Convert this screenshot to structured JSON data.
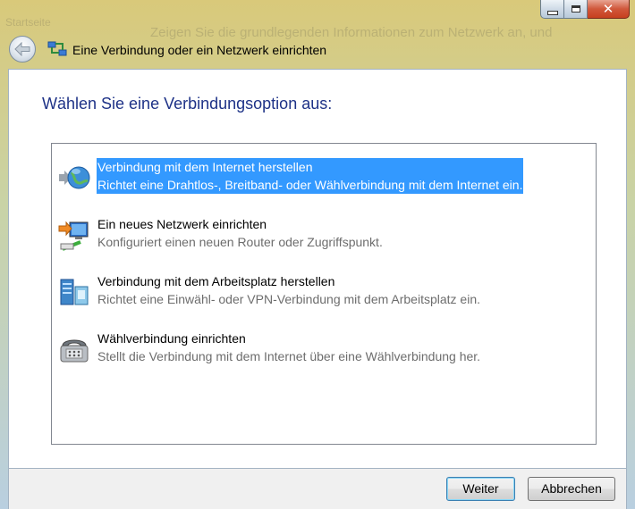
{
  "window": {
    "title": "Eine Verbindung oder ein Netzwerk einrichten",
    "background_text": "Zeigen Sie die grundlegenden Informationen zum Netzwerk an, und",
    "background_text_left": "Startseite",
    "close_glyph": "✕"
  },
  "main": {
    "heading": "Wählen Sie eine Verbindungsoption aus:",
    "options": [
      {
        "title": "Verbindung mit dem Internet herstellen",
        "description": "Richtet eine Drahtlos-, Breitband- oder Wählverbindung mit dem Internet ein.",
        "icon": "globe-internet-icon",
        "selected": true
      },
      {
        "title": "Ein neues Netzwerk einrichten",
        "description": "Konfiguriert einen neuen Router oder Zugriffspunkt.",
        "icon": "new-network-icon",
        "selected": false
      },
      {
        "title": "Verbindung mit dem Arbeitsplatz herstellen",
        "description": "Richtet eine Einwähl- oder VPN-Verbindung mit dem Arbeitsplatz ein.",
        "icon": "workplace-server-icon",
        "selected": false
      },
      {
        "title": "Wählverbindung einrichten",
        "description": "Stellt die Verbindung mit dem Internet über eine Wählverbindung her.",
        "icon": "dialup-phone-icon",
        "selected": false
      }
    ]
  },
  "footer": {
    "next_label": "Weiter",
    "cancel_label": "Abbrechen"
  },
  "colors": {
    "heading": "#1e3287",
    "selection": "#3399ff",
    "description": "#6d6d6d"
  }
}
